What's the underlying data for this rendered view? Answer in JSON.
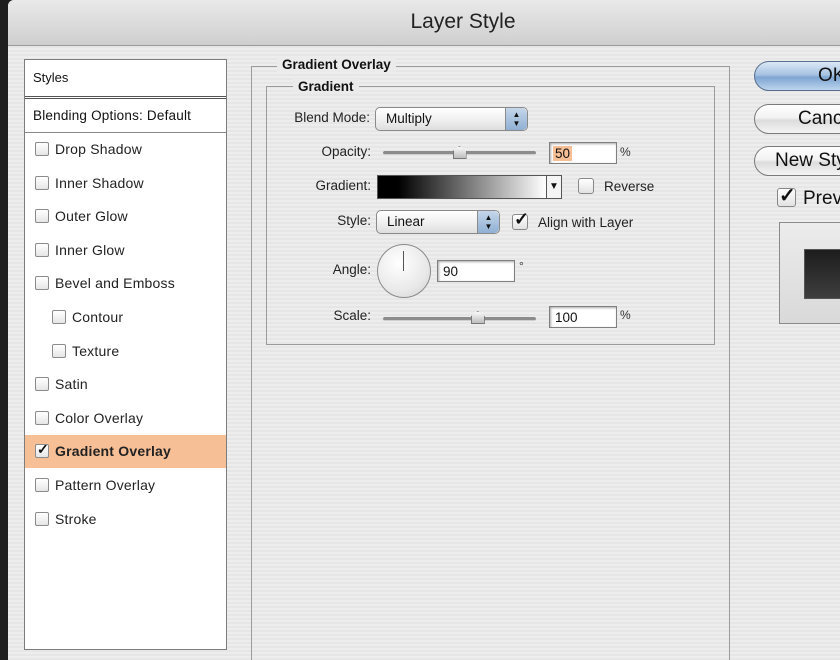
{
  "window": {
    "title": "Layer Style"
  },
  "sidebar": {
    "header": "Styles",
    "blending_options": "Blending Options: Default",
    "items": [
      {
        "label": "Drop Shadow",
        "checked": false,
        "indent": false,
        "selected": false
      },
      {
        "label": "Inner Shadow",
        "checked": false,
        "indent": false,
        "selected": false
      },
      {
        "label": "Outer Glow",
        "checked": false,
        "indent": false,
        "selected": false
      },
      {
        "label": "Inner Glow",
        "checked": false,
        "indent": false,
        "selected": false
      },
      {
        "label": "Bevel and Emboss",
        "checked": false,
        "indent": false,
        "selected": false
      },
      {
        "label": "Contour",
        "checked": false,
        "indent": true,
        "selected": false
      },
      {
        "label": "Texture",
        "checked": false,
        "indent": true,
        "selected": false
      },
      {
        "label": "Satin",
        "checked": false,
        "indent": false,
        "selected": false
      },
      {
        "label": "Color Overlay",
        "checked": false,
        "indent": false,
        "selected": false
      },
      {
        "label": "Gradient Overlay",
        "checked": true,
        "indent": false,
        "selected": true
      },
      {
        "label": "Pattern Overlay",
        "checked": false,
        "indent": false,
        "selected": false
      },
      {
        "label": "Stroke",
        "checked": false,
        "indent": false,
        "selected": false
      }
    ],
    "selected_color": "#f7bf95"
  },
  "panel": {
    "section_title": "Gradient Overlay",
    "group_title": "Gradient",
    "blend_mode": {
      "label": "Blend Mode:",
      "value": "Multiply"
    },
    "opacity": {
      "label": "Opacity:",
      "value": "50",
      "unit": "%",
      "slider_fraction": 0.5
    },
    "gradient": {
      "label": "Gradient:",
      "reverse_label": "Reverse",
      "reverse_checked": false
    },
    "style": {
      "label": "Style:",
      "value": "Linear",
      "align_label": "Align with Layer",
      "align_checked": true
    },
    "angle": {
      "label": "Angle:",
      "value": "90",
      "unit": "°"
    },
    "scale": {
      "label": "Scale:",
      "value": "100",
      "unit": "%",
      "slider_fraction": 0.62
    }
  },
  "buttons": {
    "ok": "OK",
    "cancel": "Cancel",
    "new_style": "New Style...",
    "preview": "Preview",
    "preview_checked": true
  }
}
